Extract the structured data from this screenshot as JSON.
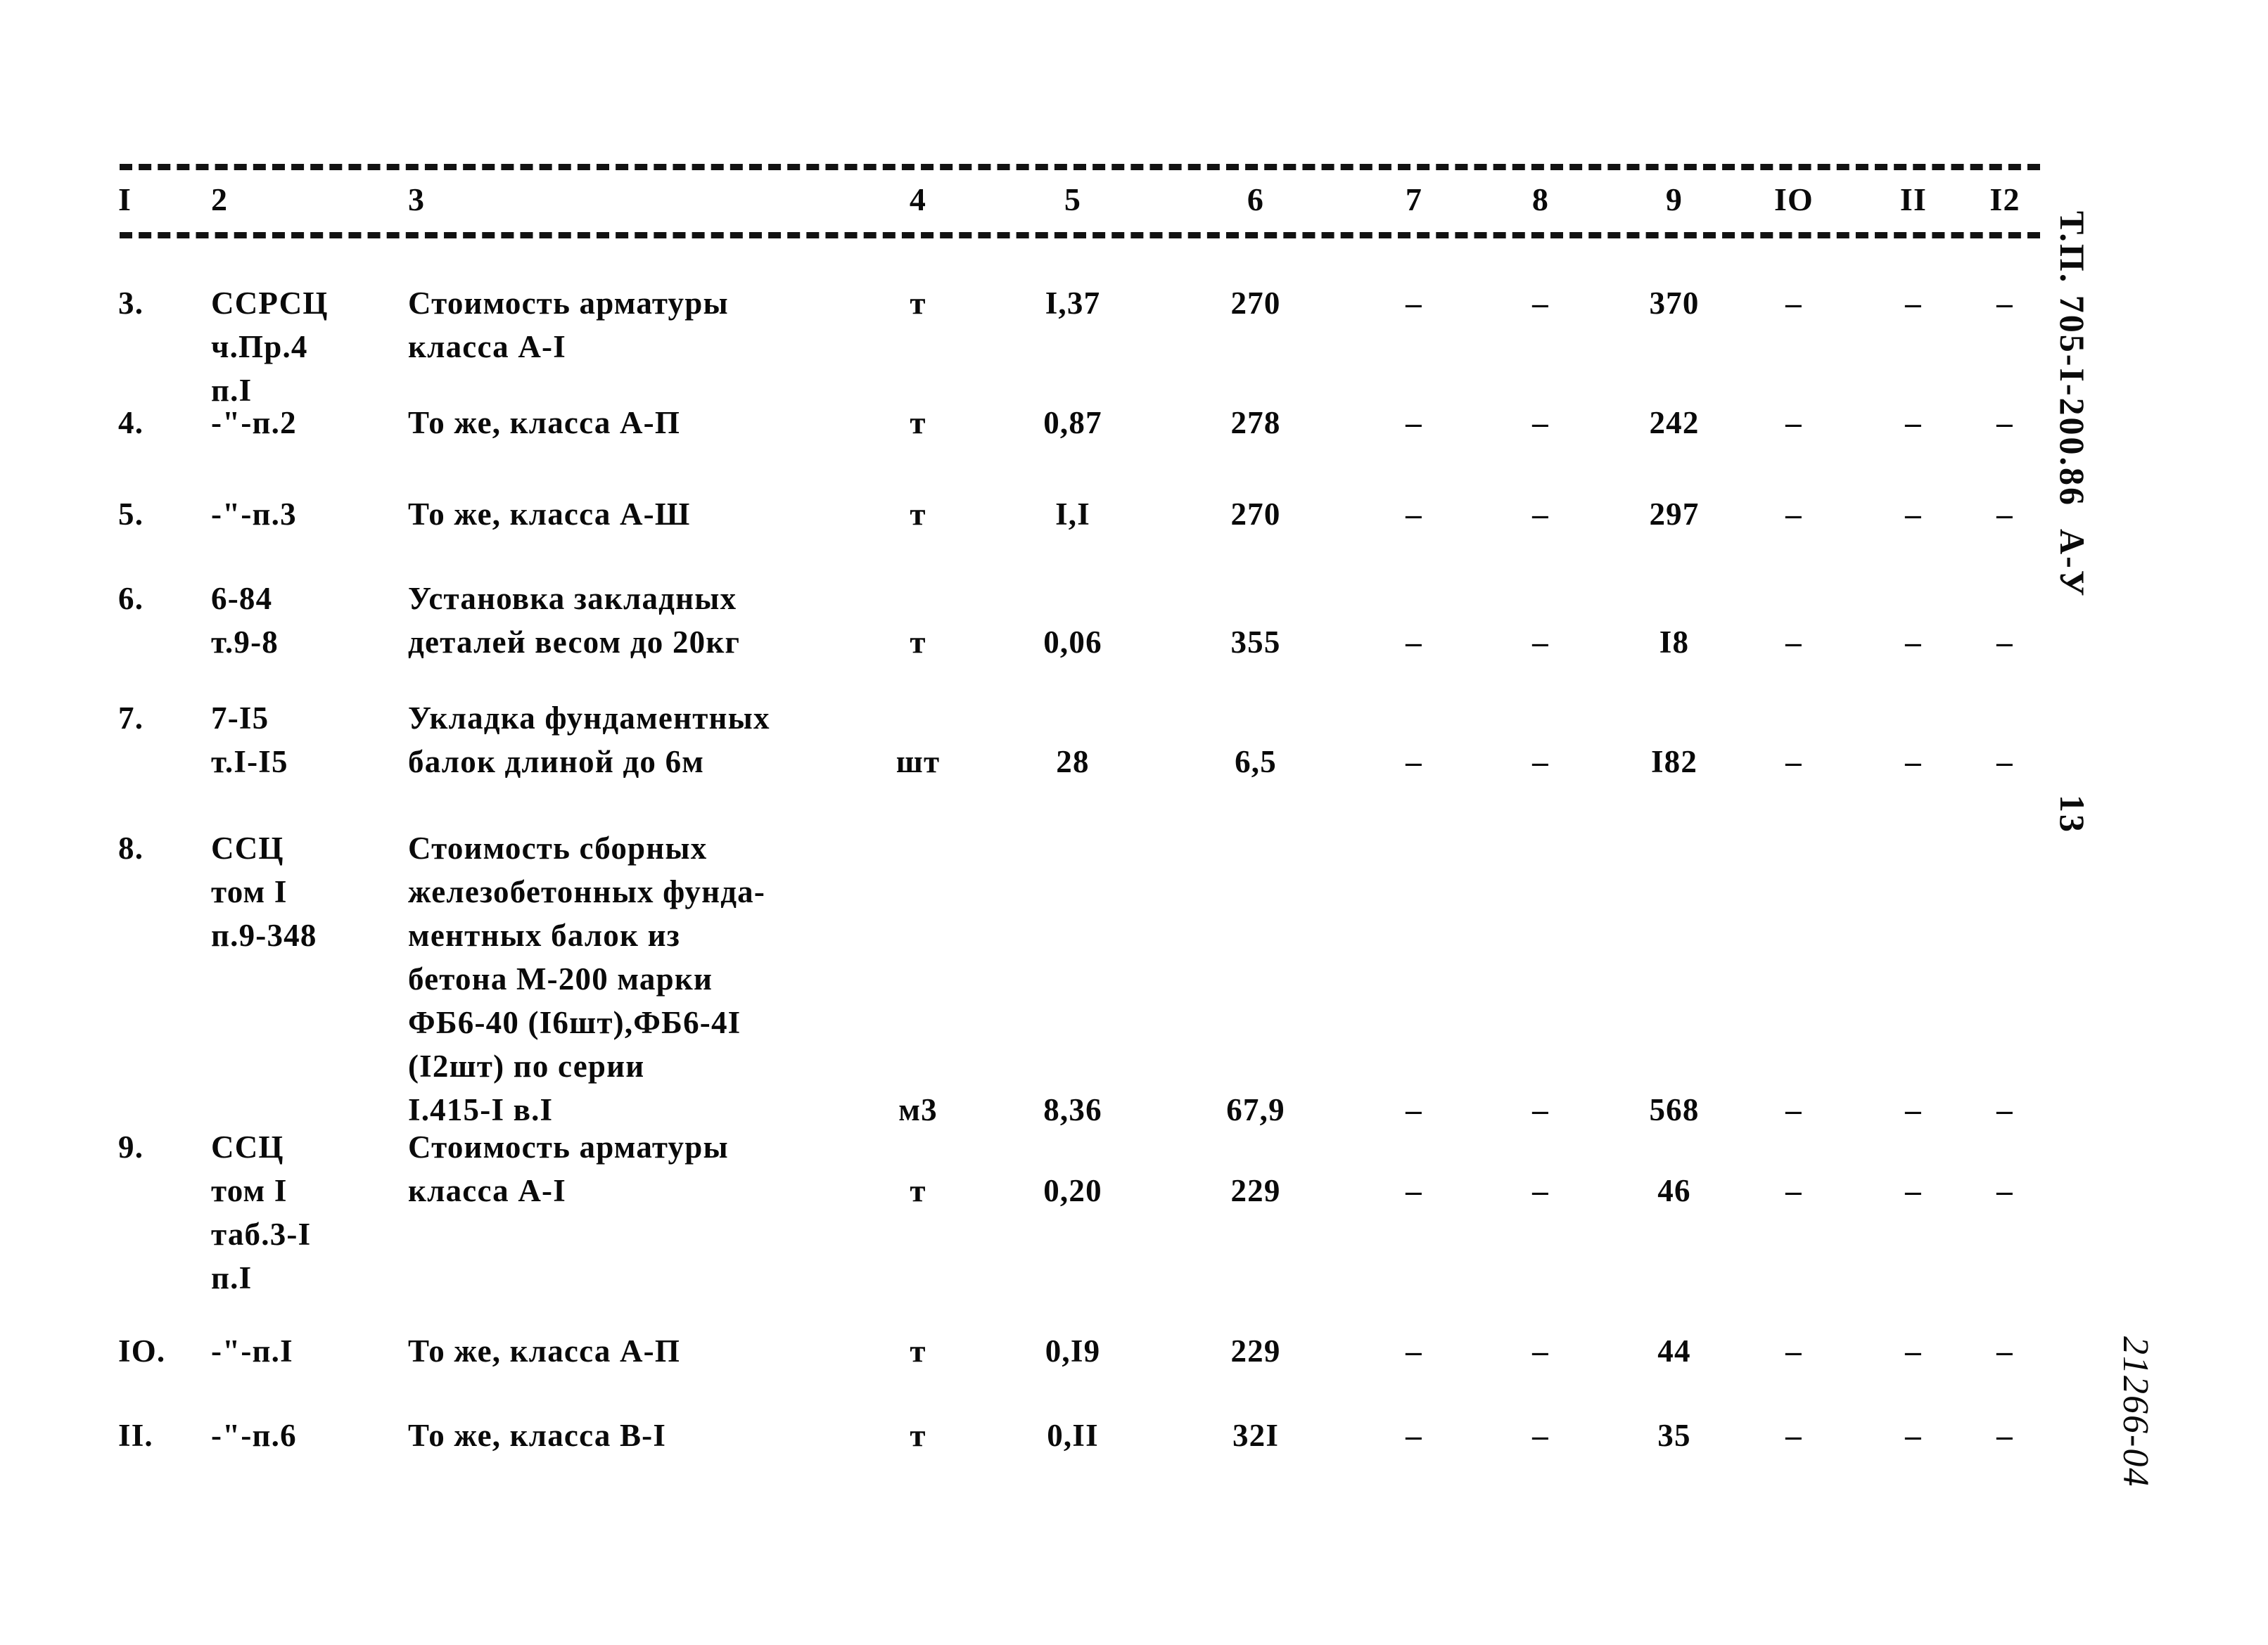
{
  "document": {
    "vertical_code": "Т.П. 705-I-200.86  А-У",
    "vertical_page": "13",
    "vertical_stamp": "21266-04"
  },
  "table": {
    "headers": [
      "I",
      "2",
      "3",
      "4",
      "5",
      "6",
      "7",
      "8",
      "9",
      "IO",
      "II",
      "I2"
    ],
    "dash": "–",
    "rows": [
      {
        "no": "3.",
        "code": [
          "ССРСЦ",
          "ч.Пр.4",
          "п.I"
        ],
        "desc": [
          "Стоимость арматуры",
          "класса А-I"
        ],
        "unit": "т",
        "qty": "I,37",
        "price": "270",
        "c7": "–",
        "c8": "–",
        "total": "370",
        "c10": "–",
        "c11": "–",
        "c12": "–"
      },
      {
        "no": "4.",
        "code": [
          "-\"-п.2"
        ],
        "desc": [
          "То же, класса А-П"
        ],
        "unit": "т",
        "qty": "0,87",
        "price": "278",
        "c7": "–",
        "c8": "–",
        "total": "242",
        "c10": "–",
        "c11": "–",
        "c12": "–"
      },
      {
        "no": "5.",
        "code": [
          "-\"-п.3"
        ],
        "desc": [
          "То же, класса А-Ш"
        ],
        "unit": "т",
        "qty": "I,I",
        "price": "270",
        "c7": "–",
        "c8": "–",
        "total": "297",
        "c10": "–",
        "c11": "–",
        "c12": "–"
      },
      {
        "no": "6.",
        "code": [
          "6-84",
          "т.9-8"
        ],
        "desc": [
          "Установка закладных",
          "деталей весом до 20кг"
        ],
        "unit": "т",
        "qty": "0,06",
        "price": "355",
        "c7": "–",
        "c8": "–",
        "total": "I8",
        "c10": "–",
        "c11": "–",
        "c12": "–"
      },
      {
        "no": "7.",
        "code": [
          "7-I5",
          "т.I-I5"
        ],
        "desc": [
          "Укладка фундаментных",
          "балок длиной до 6м"
        ],
        "unit": "шт",
        "qty": "28",
        "price": "6,5",
        "c7": "–",
        "c8": "–",
        "total": "I82",
        "c10": "–",
        "c11": "–",
        "c12": "–"
      },
      {
        "no": "8.",
        "code": [
          "ССЦ",
          "том I",
          "п.9-348"
        ],
        "desc": [
          "Стоимость сборных",
          "железобетонных фунда-",
          "ментных балок из",
          "бетона М-200 марки",
          "ФБ6-40 (I6шт),ФБ6-4I",
          "(I2шт) по серии",
          "I.415-I в.I"
        ],
        "unit": "м3",
        "qty": "8,36",
        "price": "67,9",
        "c7": "–",
        "c8": "–",
        "total": "568",
        "c10": "–",
        "c11": "–",
        "c12": "–"
      },
      {
        "no": "9.",
        "code": [
          "ССЦ",
          "том I",
          "таб.3-I",
          "п.I"
        ],
        "desc": [
          "Стоимость арматуры",
          "класса А-I"
        ],
        "unit": "т",
        "qty": "0,20",
        "price": "229",
        "c7": "–",
        "c8": "–",
        "total": "46",
        "c10": "–",
        "c11": "–",
        "c12": "–"
      },
      {
        "no": "IO.",
        "code": [
          "-\"-п.I"
        ],
        "desc": [
          "То же, класса А-П"
        ],
        "unit": "т",
        "qty": "0,I9",
        "price": "229",
        "c7": "–",
        "c8": "–",
        "total": "44",
        "c10": "–",
        "c11": "–",
        "c12": "–"
      },
      {
        "no": "II.",
        "code": [
          "-\"-п.6"
        ],
        "desc": [
          "То же, класса В-I"
        ],
        "unit": "т",
        "qty": "0,II",
        "price": "32I",
        "c7": "–",
        "c8": "–",
        "total": "35",
        "c10": "–",
        "c11": "–",
        "c12": "–"
      }
    ]
  }
}
